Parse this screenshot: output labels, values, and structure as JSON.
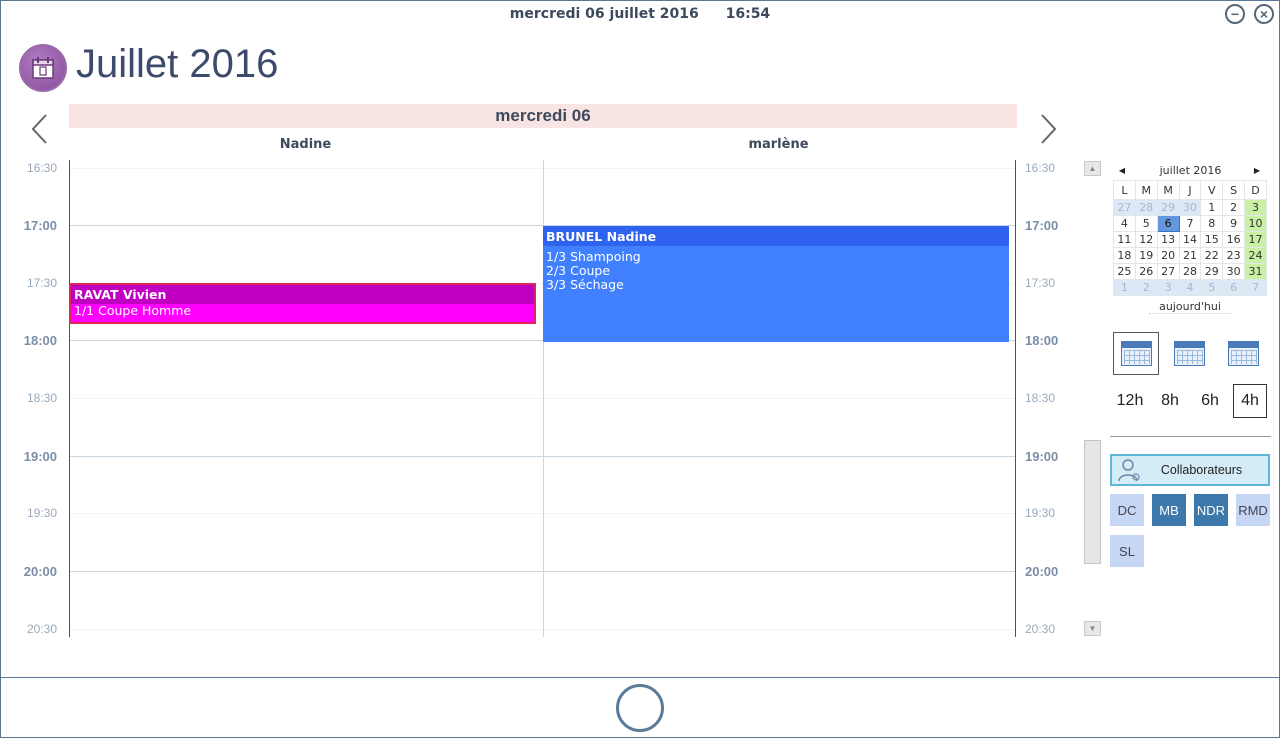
{
  "header": {
    "date": "mercredi 06 juillet 2016",
    "time": "16:54",
    "title": "Juillet 2016",
    "day_label": "mercredi 06"
  },
  "window": {
    "minimize_icon": "minus-circle-icon",
    "close_icon": "close-circle-icon"
  },
  "navigation": {
    "prev_icon": "chevron-left-icon",
    "next_icon": "chevron-right-icon"
  },
  "columns": [
    "Nadine",
    "marlène"
  ],
  "time_slots": [
    "16:30",
    "17:00",
    "17:30",
    "18:00",
    "18:30",
    "19:00",
    "19:30",
    "20:00",
    "20:30"
  ],
  "appointments": [
    {
      "client": "RAVAT Vivien",
      "lines": [
        "1/1  Coupe Homme"
      ],
      "color": "#ff00ff",
      "header_color": "#c000c0",
      "border_color": "#e0245e"
    },
    {
      "client": "BRUNEL Nadine",
      "lines": [
        "1/3  Shampoing",
        "2/3  Coupe",
        "3/3  Séchage"
      ],
      "color": "#4080ff",
      "header_color": "#2f63ef"
    }
  ],
  "mini_calendar": {
    "month": "juillet 2016",
    "weekdays": [
      "L",
      "M",
      "M",
      "J",
      "V",
      "S",
      "D"
    ],
    "today_label": "aujourd'hui",
    "weeks": [
      [
        "27",
        "28",
        "29",
        "30",
        "1",
        "2",
        "3"
      ],
      [
        "4",
        "5",
        "6",
        "7",
        "8",
        "9",
        "10"
      ],
      [
        "11",
        "12",
        "13",
        "14",
        "15",
        "16",
        "17"
      ],
      [
        "18",
        "19",
        "20",
        "21",
        "22",
        "23",
        "24"
      ],
      [
        "25",
        "26",
        "27",
        "28",
        "29",
        "30",
        "31"
      ],
      [
        "1",
        "2",
        "3",
        "4",
        "5",
        "6",
        "7"
      ]
    ]
  },
  "zoom_options": [
    "12h",
    "8h",
    "6h",
    "4h"
  ],
  "zoom_selected": "4h",
  "collaborators_label": "Collaborateurs",
  "staff": [
    {
      "code": "DC",
      "active": false
    },
    {
      "code": "MB",
      "active": true
    },
    {
      "code": "NDR",
      "active": true
    },
    {
      "code": "RMD",
      "active": false
    },
    {
      "code": "SL",
      "active": false
    }
  ],
  "colors": {
    "accent": "#3d78aa",
    "sunday": "#c9f0a4",
    "today": "#6497de",
    "day_header": "#f9e4e4"
  }
}
